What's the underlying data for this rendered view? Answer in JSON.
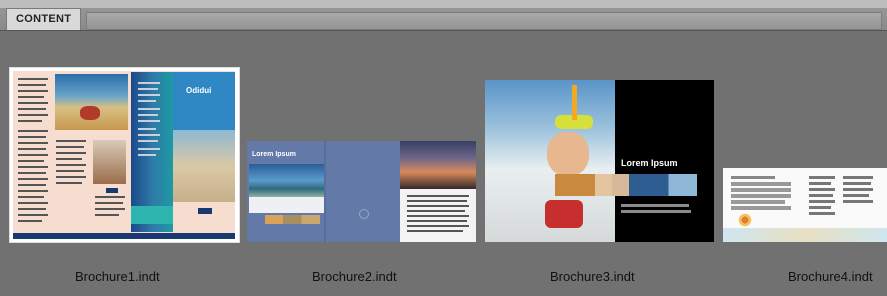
{
  "panel": {
    "tab_label": "CONTENT"
  },
  "files": [
    {
      "name": "Brochure1.indt",
      "thumb_heading": "Odidui"
    },
    {
      "name": "Brochure2.indt",
      "thumb_heading": "Lorem Ipsum"
    },
    {
      "name": "Brochure3.indt",
      "thumb_heading": "Lorem Ipsum"
    },
    {
      "name": "Brochure4.indt"
    }
  ],
  "colors": {
    "background": "#717171",
    "tab": "#d9d9d9",
    "selection_border": "#ffffff"
  }
}
